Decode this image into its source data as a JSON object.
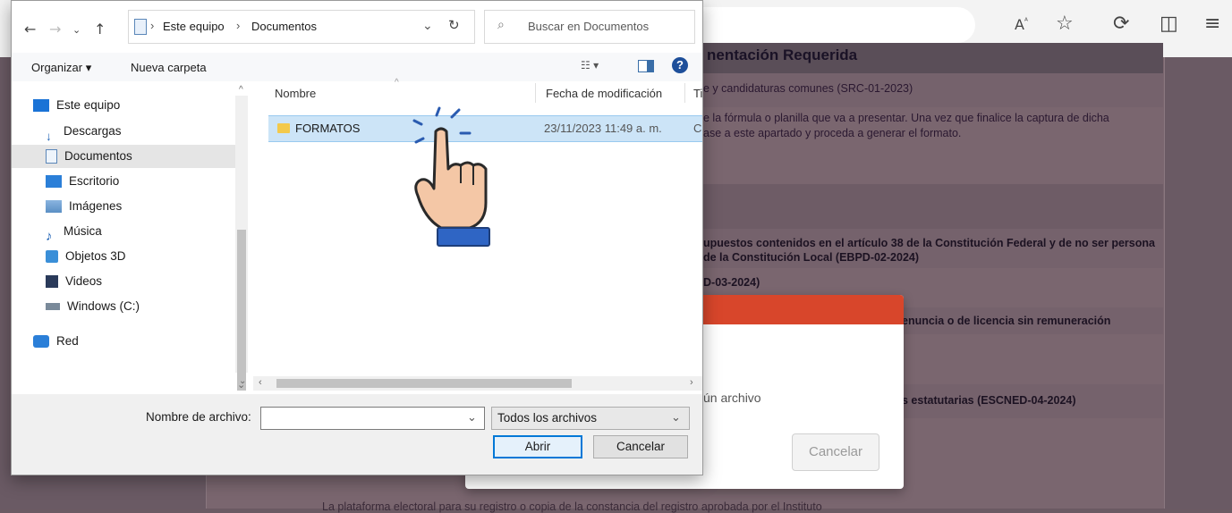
{
  "dialog": {
    "breadcrumb": [
      "Este equipo",
      "Documentos"
    ],
    "search_placeholder": "Buscar en Documentos",
    "toolbar": {
      "organize": "Organizar ▾",
      "new_folder": "Nueva carpeta"
    },
    "sidebar": [
      {
        "label": "Este equipo",
        "icon": "computer-icon"
      },
      {
        "label": "Descargas",
        "icon": "download-icon"
      },
      {
        "label": "Documentos",
        "icon": "documents-icon",
        "selected": true
      },
      {
        "label": "Escritorio",
        "icon": "desktop-icon"
      },
      {
        "label": "Imágenes",
        "icon": "pictures-icon"
      },
      {
        "label": "Música",
        "icon": "music-icon"
      },
      {
        "label": "Objetos 3D",
        "icon": "3d-objects-icon"
      },
      {
        "label": "Videos",
        "icon": "videos-icon"
      },
      {
        "label": "Windows (C:)",
        "icon": "drive-icon"
      },
      {
        "label": "Red",
        "icon": "network-icon"
      }
    ],
    "columns": {
      "name": "Nombre",
      "modified": "Fecha de modificación",
      "type": "Ti"
    },
    "files": [
      {
        "name": "FORMATOS",
        "modified": "23/11/2023 11:49 a. m.",
        "type": "C"
      }
    ],
    "filename_label": "Nombre de archivo:",
    "filename_value": "",
    "filter": "Todos los archivos",
    "open_button": "Abrir",
    "cancel_button": "Cancelar"
  },
  "background": {
    "section_title": "nentación Requerida",
    "lines": [
      "e y candidaturas comunes (SRC-01-2023)",
      "e la fórmula o planilla que va a presentar. Una vez que finalice la captura de dicha",
      "ase a este apartado y proceda a generar el formato.",
      "upuestos contenidos en el artículo 38 de la Constitución Federal y de no ser persona",
      "de la Constitución Local (EBPD-02-2024)",
      "D-03-2024)",
      "enuncia o de licencia sin remuneración",
      "s estatutarias (ESCNED-04-2024)",
      "La plataforma electoral para su registro o copia de la constancia del registro aprobada por el Instituto"
    ],
    "modal": {
      "file_text": "ún archivo",
      "cancel": "Cancelar"
    }
  },
  "colors": {
    "accent": "#0078d7",
    "selection": "#cce4f7",
    "modal_header": "#d8462b"
  }
}
